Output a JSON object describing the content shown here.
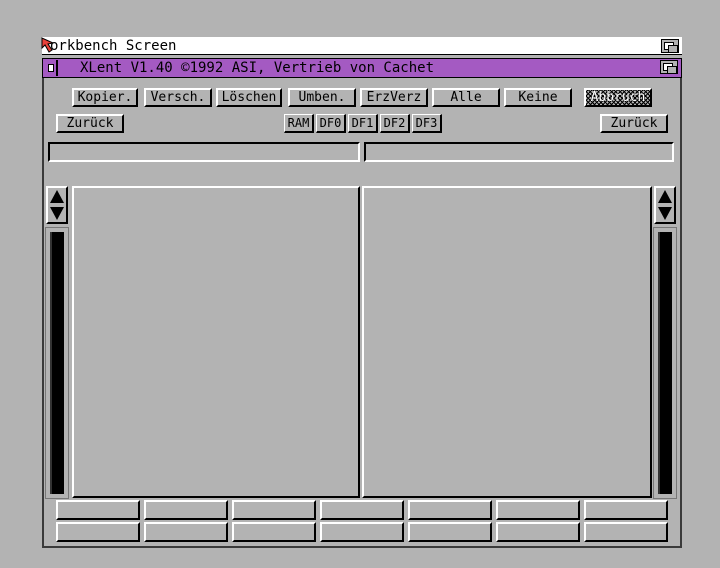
{
  "screen": {
    "title": "Workbench Screen",
    "title_visible": "orkbench Screen"
  },
  "window": {
    "title": "XLent V1.40 ©1992 ASI, Vertrieb von Cachet"
  },
  "toolbar": {
    "copy": "Kopier.",
    "move": "Versch.",
    "delete": "Löschen",
    "rename": "Umben.",
    "makedir": "ErzVerz",
    "all": "Alle",
    "none": "Keine",
    "cancel": "Abbruch"
  },
  "nav": {
    "back_left": "Zurück",
    "back_right": "Zurück",
    "drives": [
      "RAM",
      "DF0",
      "DF1",
      "DF2",
      "DF3"
    ]
  },
  "paths": {
    "left": "",
    "right": ""
  },
  "icons": {
    "pointer": "amiga-pointer-icon",
    "depth": "depth-gadget-icon",
    "close": "close-gadget-icon",
    "scroll": "up-down-arrows-icon"
  },
  "colors": {
    "background": "#b3b3b3",
    "titlebar": "#a45ac2",
    "pointer": "#e8413a"
  }
}
